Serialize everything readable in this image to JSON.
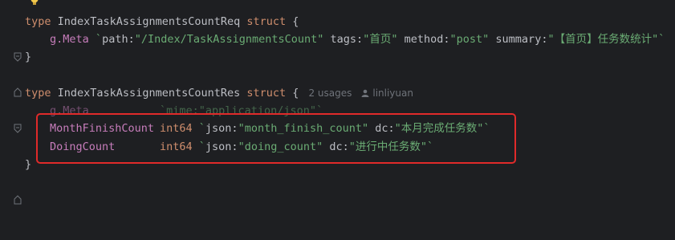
{
  "colors": {
    "background": "#1e1f22",
    "keyword": "#cf8e6d",
    "string": "#6aab73",
    "field": "#c77dbb",
    "text": "#bcbec4",
    "hint": "#6f737a",
    "highlight": "#e02a2a"
  },
  "icons": {
    "lightbulb": "lightbulb-icon",
    "fold": "fold-marker-icon",
    "user": "user-icon"
  },
  "code": {
    "struct1": {
      "kw_type": "type",
      "name": "IndexTaskAssignmentsCountReq",
      "kw_struct": "struct",
      "open": "{",
      "line2": {
        "field": "g.Meta",
        "tick_open": "`",
        "k1": "path:",
        "v1": "\"/Index/TaskAssignmentsCount\"",
        "k2": "tags:",
        "v2": "\"首页\"",
        "k3": "method:",
        "v3": "\"post\"",
        "k4": "summary:",
        "v4": "\"【首页】任务数统计\"",
        "tick_close": "`"
      },
      "close": "}"
    },
    "struct2": {
      "kw_type": "type",
      "name": "IndexTaskAssignmentsCountRes",
      "kw_struct": "struct",
      "open": "{",
      "usages": "2 usages",
      "author": "linliyuan",
      "meta_line": {
        "field": "g.Meta",
        "tag": "`mime:\"application/json\"`"
      },
      "line_month": {
        "field": "MonthFinishCount",
        "type": "int64",
        "tick_open": "`",
        "k1": "json:",
        "v1": "\"month_finish_count\"",
        "k2": "dc:",
        "v2": "\"本月完成任务数\"",
        "tick_close": "`"
      },
      "line_doing": {
        "field": "DoingCount",
        "type": "int64",
        "tick_open": "`",
        "k1": "json:",
        "v1": "\"doing_count\"",
        "k2": "dc:",
        "v2": "\"进行中任务数\"",
        "tick_close": "`"
      },
      "close": "}"
    }
  }
}
